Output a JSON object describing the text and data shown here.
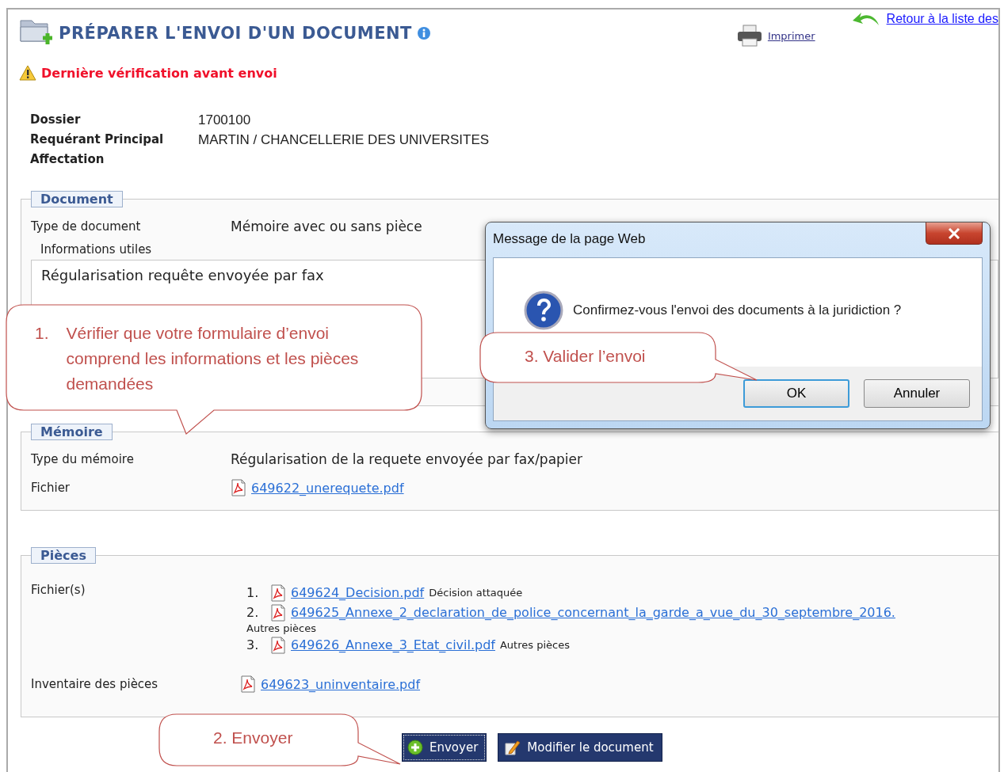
{
  "header": {
    "title": "PRÉPARER L'ENVOI D'UN DOCUMENT",
    "print_link": "Imprimer",
    "back_link": "Retour à la liste des"
  },
  "warning": "Dernière vérification avant envoi",
  "summary": [
    {
      "label": "Dossier",
      "value": "1700100"
    },
    {
      "label": "Requérant Principal",
      "value": "MARTIN  / CHANCELLERIE DES UNIVERSITES"
    },
    {
      "label": "Affectation"
    }
  ],
  "document": {
    "legend": "Document",
    "type_label": "Type de document",
    "type_value": "Mémoire avec ou sans pièce",
    "info_label": "Informations utiles",
    "info_value": "Régularisation requête envoyée par fax"
  },
  "memoire": {
    "legend": "Mémoire",
    "type_label": "Type du mémoire",
    "type_value": "Régularisation de la requete envoyée par fax/papier",
    "file_label": "Fichier",
    "file_link": "649622_unerequete.pdf"
  },
  "pieces": {
    "legend": "Pièces",
    "files_label": "Fichier(s)",
    "files": [
      {
        "number": "1.",
        "link": "649624_Decision.pdf",
        "description": "Décision attaquée",
        "wrapped": false
      },
      {
        "number": "2.",
        "link": "649625_Annexe_2_declaration_de_police_concernant_la_garde_a_vue_du_30_septembre_2016.",
        "description": "Autres pièces",
        "wrapped": true
      },
      {
        "number": "3.",
        "link": "649626_Annexe_3_Etat_civil.pdf",
        "description": "Autres pièces",
        "wrapped": false
      }
    ],
    "inventory_label": "Inventaire des pièces",
    "inventory_link": "649623_uninventaire.pdf"
  },
  "buttons": [
    {
      "label": "Envoyer",
      "kind": "send",
      "focused": true
    },
    {
      "label": "Modifier le document",
      "kind": "edit",
      "focused": false
    }
  ],
  "dialog": {
    "title": "Message de la page Web",
    "message": "Confirmez-vous l'envoi des documents à la juridiction ?",
    "buttons": [
      {
        "label": "OK",
        "focused": true
      },
      {
        "label": "Annuler",
        "focused": false
      }
    ]
  },
  "callouts": [
    {
      "number": "1.",
      "text": "Vérifier que votre formulaire d’envoi comprend les informations et les pièces demandées"
    },
    {
      "text": "3. Valider l’envoi"
    },
    {
      "text": "2. Envoyer"
    }
  ]
}
